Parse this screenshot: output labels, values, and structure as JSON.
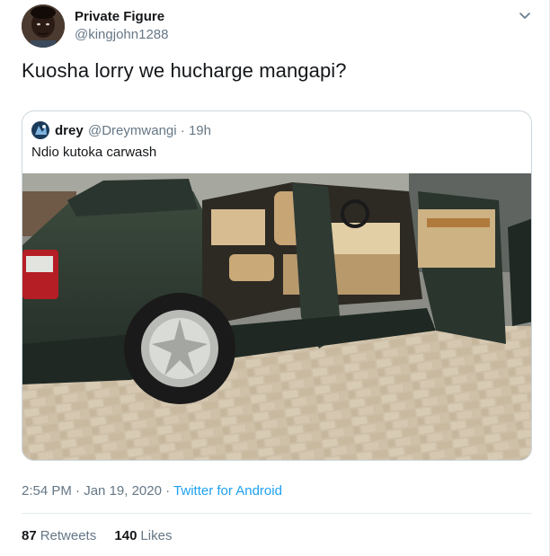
{
  "tweet": {
    "author": {
      "display_name": "Private Figure",
      "handle": "@kingjohn1288"
    },
    "text": "Kuosha lorry we hucharge mangapi?",
    "menu_icon": "chevron-down-icon",
    "quoted": {
      "author": {
        "display_name": "drey",
        "handle": "@Dreymwangi",
        "time": "19h"
      },
      "text": "Ndio kutoka carwash",
      "photo_icon": "car-photo"
    },
    "timestamp": {
      "time": "2:54 PM",
      "date": "Jan 19, 2020",
      "source": "Twitter for Android"
    },
    "stats": {
      "retweets_count": "87",
      "retweets_label": "Retweets",
      "likes_count": "140",
      "likes_label": "Likes"
    }
  },
  "colors": {
    "primary_text": "#14171a",
    "secondary_text": "#657786",
    "link": "#1da1f2",
    "border": "#ccd6dd"
  }
}
